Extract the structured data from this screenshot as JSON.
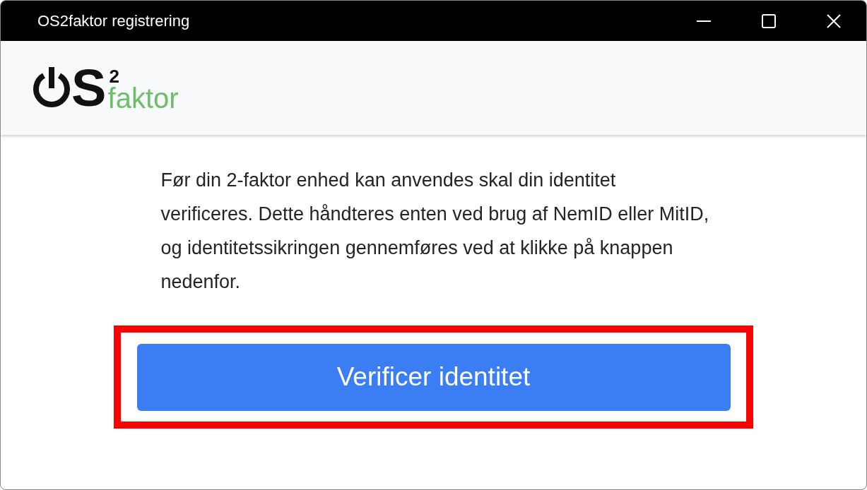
{
  "window": {
    "title": "OS2faktor registrering"
  },
  "logo": {
    "letter": "S",
    "superscript": "2",
    "word": "faktor"
  },
  "message": "Før din 2-faktor enhed kan anvendes skal din identitet verificeres. Dette håndteres enten ved brug af NemID eller MitID, og identitetssikringen gennemføres ved at klikke på knappen nedenfor.",
  "button": {
    "label": "Verificer identitet",
    "highlighted": true
  }
}
